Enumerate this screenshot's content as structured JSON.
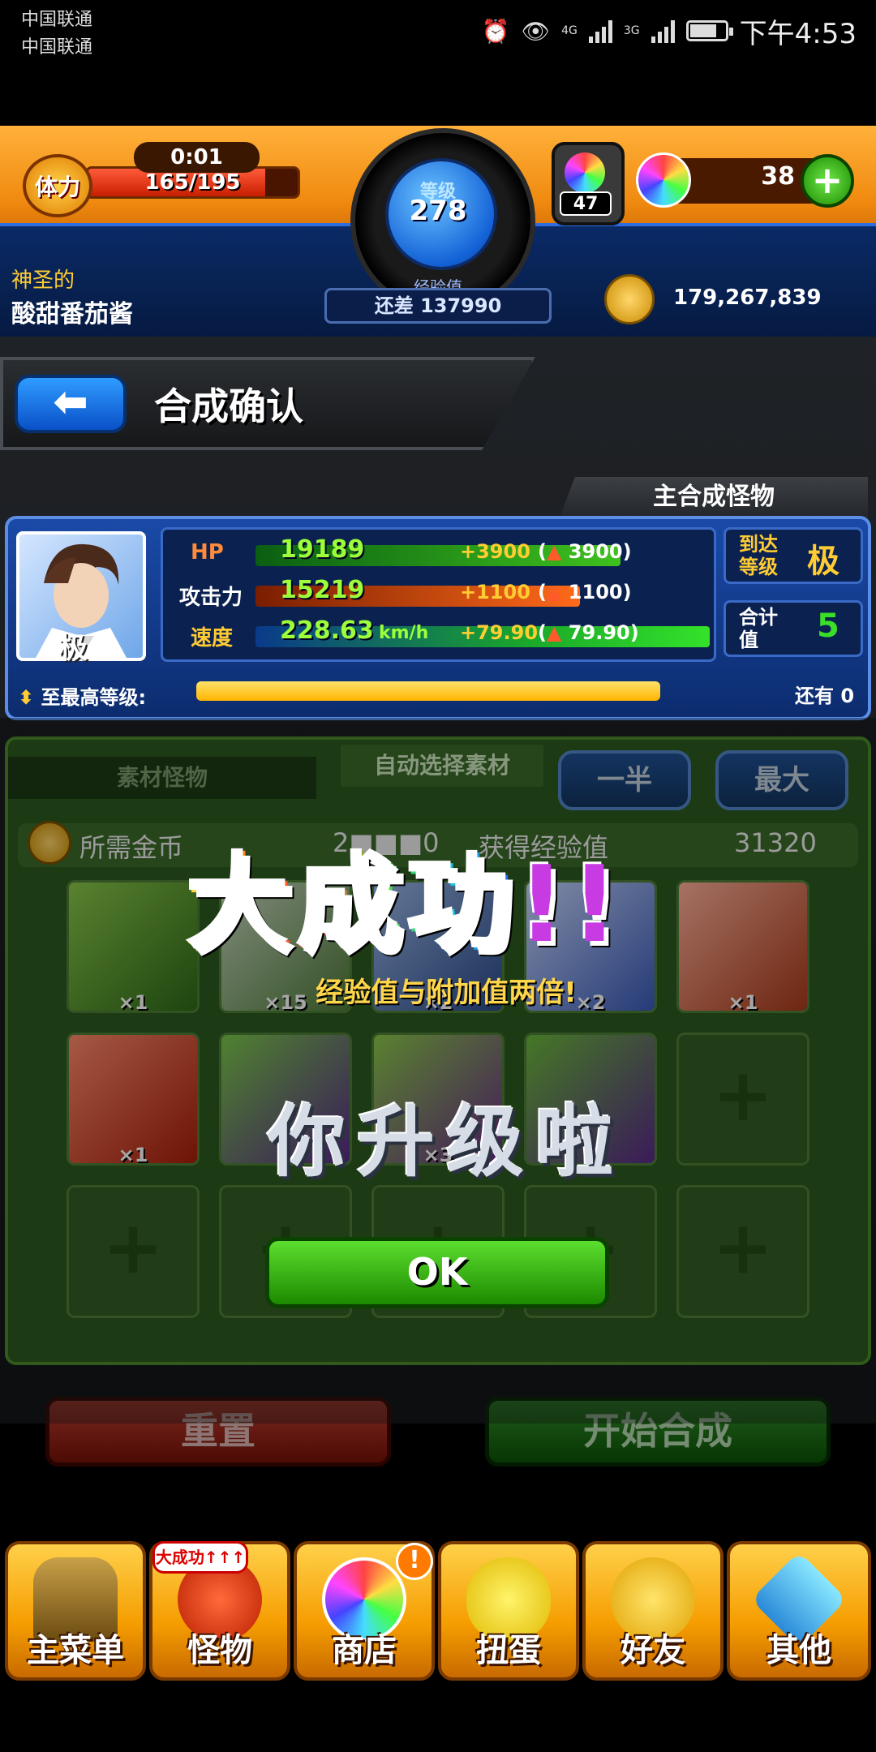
{
  "status_bar": {
    "carrier1": "中国联通",
    "carrier2": "中国联通",
    "net1": "4G",
    "net2": "3G",
    "time": "下午4:53"
  },
  "hud": {
    "stamina_label": "体力",
    "stamina_timer": "0:01",
    "stamina_text": "165/195",
    "stamina_fraction": 0.846,
    "level_label": "等级",
    "level_value": "278",
    "exp_label": "经验值",
    "exp_remaining": "还差 137990",
    "gacha_count": "47",
    "orb_count": "38",
    "orb_add": "+",
    "player_title": "神圣的",
    "player_name": "酸甜番茄酱",
    "gold": "179,267,839"
  },
  "header": {
    "back": "⬅",
    "title": "合成确认"
  },
  "main_monster": {
    "tab_label": "主合成怪物",
    "grade": "极",
    "stats": [
      {
        "label": "HP",
        "value": "19189",
        "bonus": "+3900",
        "bonus_paren": "3900"
      },
      {
        "label": "攻击力",
        "value": "15219",
        "bonus": "+1100",
        "bonus_paren": "1100"
      },
      {
        "label": "速度",
        "value": "228.63",
        "unit": "km/h",
        "bonus": "+79.90",
        "bonus_paren": "79.90"
      }
    ],
    "reach_label": "到达等级",
    "reach_value": "极",
    "luck_label": "合计值",
    "luck_value": "5",
    "maxlv_label": "至最高等级:",
    "maxlv_remaining": "还有 0",
    "maxlv_fraction": 1.0
  },
  "materials": {
    "tab_materials": "素材怪物",
    "tab_auto": "自动选择素材",
    "btn_half": "一半",
    "btn_max": "最大",
    "cost_label": "所需金币",
    "cost_value": "2■■■0",
    "exp_gain_label": "获得经验值",
    "exp_gain_value": "31320",
    "row1": [
      "×1",
      "×15",
      "×2",
      "×2",
      "×1"
    ],
    "row2": [
      "×1",
      "",
      "×3",
      "",
      ""
    ],
    "empty_symbol": "+"
  },
  "popup": {
    "success": "大成功",
    "success_mark": "!!",
    "subtitle": "经验值与附加值两倍!",
    "levelup": "你升级啦",
    "ok": "OK"
  },
  "actions": {
    "reset": "重置",
    "start": "开始合成"
  },
  "nav": {
    "items": [
      {
        "label": "主菜单",
        "icon": "castle-gate-icon"
      },
      {
        "label": "怪物",
        "icon": "monster-icon"
      },
      {
        "label": "商店",
        "icon": "rainbow-orb-icon"
      },
      {
        "label": "扭蛋",
        "icon": "egg-icon"
      },
      {
        "label": "好友",
        "icon": "friends-icon"
      },
      {
        "label": "其他",
        "icon": "question-icon"
      }
    ],
    "monster_bubble": "大成功↑↑↑",
    "shop_alert": "!"
  },
  "colors": {
    "hud_orange": "#f08a10",
    "panel_blue": "#1a4aa8",
    "panel_green": "#2c5a1e",
    "ok_green": "#5cde2e",
    "reset_red": "#e24a3a"
  }
}
